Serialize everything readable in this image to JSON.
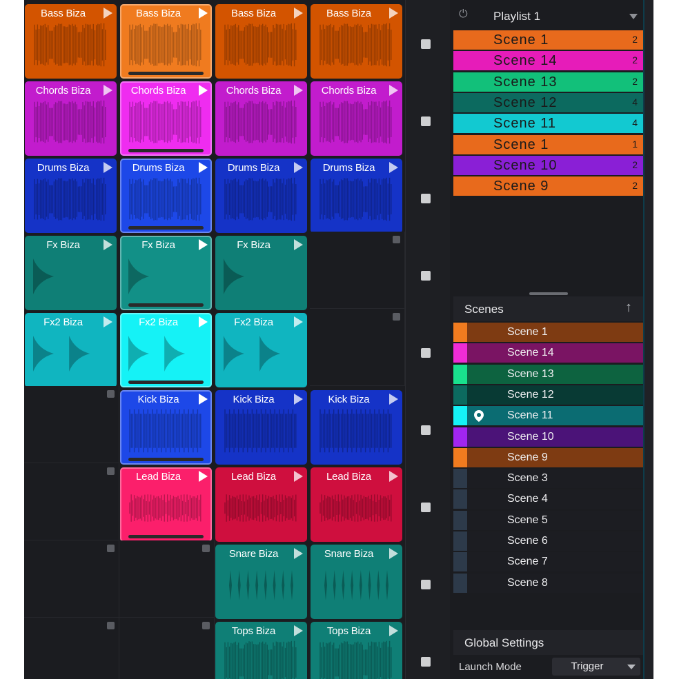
{
  "clip_rows": [
    {
      "track": "bass",
      "title": "Bass Biza",
      "color": "#d35400",
      "sel_color": "#f07b1f",
      "wave": "dense",
      "cells": [
        "clip",
        "sel",
        "clip",
        "clip"
      ]
    },
    {
      "track": "chords",
      "title": "Chords Biza",
      "color": "#c21ccd",
      "sel_color": "#ef2cf0",
      "wave": "dense",
      "cells": [
        "clip",
        "sel",
        "clip",
        "clip"
      ]
    },
    {
      "track": "drums",
      "title": "Drums Biza",
      "color": "#1533c7",
      "sel_color": "#1d48e8",
      "wave": "dense",
      "cells": [
        "clip",
        "sel",
        "clip",
        "clip"
      ]
    },
    {
      "track": "fx",
      "title": "Fx Biza",
      "color": "#0f7f76",
      "sel_color": "#129087",
      "wave": "decay",
      "cells": [
        "clip",
        "sel",
        "clip",
        "empty"
      ]
    },
    {
      "track": "fx2",
      "title": "Fx2 Biza",
      "color": "#10b5c0",
      "sel_color": "#15f2f6",
      "wave": "decay2",
      "cells": [
        "clip",
        "sel",
        "clip",
        "empty"
      ]
    },
    {
      "track": "kick",
      "title": "Kick Biza",
      "color": "#1533c7",
      "sel_color": "#1d48e8",
      "wave": "kick",
      "cells": [
        "empty",
        "sel",
        "clip",
        "clip"
      ]
    },
    {
      "track": "lead",
      "title": "Lead Biza",
      "color": "#cf0f3e",
      "sel_color": "#fb1f6b",
      "wave": "lead",
      "cells": [
        "empty",
        "sel",
        "clip",
        "clip"
      ]
    },
    {
      "track": "snare",
      "title": "Snare Biza",
      "color": "#0f7f76",
      "sel_color": "#129087",
      "wave": "snare",
      "cells": [
        "empty",
        "empty",
        "clip",
        "clip"
      ]
    },
    {
      "track": "tops",
      "title": "Tops Biza",
      "color": "#0f7f76",
      "sel_color": "#129087",
      "wave": "dense",
      "cells": [
        "empty",
        "empty",
        "clip",
        "clip"
      ]
    }
  ],
  "playlist": {
    "title": "Playlist 1",
    "items": [
      {
        "name": "Scene 1",
        "count": "2",
        "color": "#e86a1c"
      },
      {
        "name": "Scene 14",
        "count": "2",
        "color": "#e61cb9"
      },
      {
        "name": "Scene 13",
        "count": "2",
        "color": "#12c07a"
      },
      {
        "name": "Scene 12",
        "count": "4",
        "color": "#0c6a5f"
      },
      {
        "name": "Scene 11",
        "count": "4",
        "color": "#12c9d1"
      },
      {
        "name": "Scene 1",
        "count": "1",
        "color": "#e86a1c"
      },
      {
        "name": "Scene 10",
        "count": "2",
        "color": "#8a1fd6"
      },
      {
        "name": "Scene 9",
        "count": "2",
        "color": "#e86a1c"
      }
    ]
  },
  "scenes": {
    "title": "Scenes",
    "items": [
      {
        "name": "Scene 1",
        "swatch": "#f07b1f",
        "bg": "#7e3b12"
      },
      {
        "name": "Scene 14",
        "swatch": "#ef2cd6",
        "bg": "#7a1463"
      },
      {
        "name": "Scene 13",
        "swatch": "#19e08d",
        "bg": "#0d6340"
      },
      {
        "name": "Scene 12",
        "swatch": "#0c6a5f",
        "bg": "#083a34"
      },
      {
        "name": "Scene 11",
        "swatch": "#15f2f6",
        "bg": "#0b6c72",
        "pinned": true
      },
      {
        "name": "Scene 10",
        "swatch": "#a125f0",
        "bg": "#4b1378"
      },
      {
        "name": "Scene 9",
        "swatch": "#f07b1f",
        "bg": "#7e3b12"
      },
      {
        "name": "Scene 3",
        "swatch": "#2d3a4a",
        "bg": "#1c1d22"
      },
      {
        "name": "Scene 4",
        "swatch": "#2d3a4a",
        "bg": "#1c1d22"
      },
      {
        "name": "Scene 5",
        "swatch": "#2d3a4a",
        "bg": "#1c1d22"
      },
      {
        "name": "Scene 6",
        "swatch": "#2d3a4a",
        "bg": "#1c1d22"
      },
      {
        "name": "Scene 7",
        "swatch": "#2d3a4a",
        "bg": "#1c1d22"
      },
      {
        "name": "Scene 8",
        "swatch": "#2d3a4a",
        "bg": "#1c1d22"
      }
    ]
  },
  "global_settings": {
    "title": "Global Settings",
    "launch_mode_label": "Launch Mode",
    "launch_mode_value": "Trigger"
  }
}
